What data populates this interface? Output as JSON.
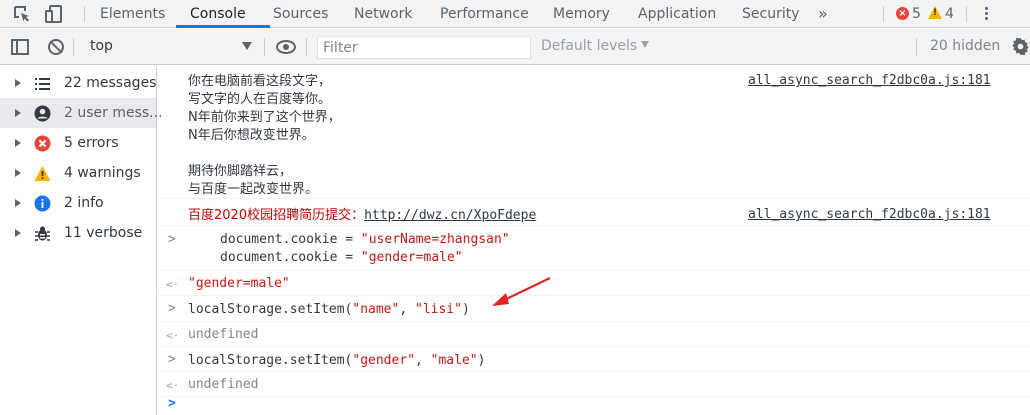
{
  "tabs": [
    "Elements",
    "Console",
    "Sources",
    "Network",
    "Performance",
    "Memory",
    "Application",
    "Security"
  ],
  "active_tab": "Console",
  "more_tabs": "»",
  "error_count": "5",
  "warning_count": "4",
  "toolbar": {
    "context": "top",
    "filter_placeholder": "Filter",
    "levels": "Default levels",
    "hidden": "20 hidden"
  },
  "sidebar": [
    {
      "label": "22 messages",
      "icon": "list-icon"
    },
    {
      "label": "2 user mess...",
      "icon": "user-icon"
    },
    {
      "label": "5 errors",
      "icon": "error-icon"
    },
    {
      "label": "4 warnings",
      "icon": "warning-icon"
    },
    {
      "label": "2 info",
      "icon": "info-icon"
    },
    {
      "label": "11 verbose",
      "icon": "bug-icon"
    }
  ],
  "log1": {
    "lines": [
      "你在电脑前看这段文字，",
      "写文字的人在百度等你。",
      "N年前你来到了这个世界，",
      "N年后你想改变世界。",
      "",
      "期待你脚踏祥云，",
      "与百度一起改变世界。"
    ],
    "source": "all_async_search_f2dbc0a.js:181"
  },
  "log2": {
    "prefix": "百度2020校园招聘简历提交：",
    "url": "http://dwz.cn/XpoFdepe",
    "source": "all_async_search_f2dbc0a.js:181"
  },
  "cmd1": {
    "line1_code": "document.cookie = ",
    "line1_str": "\"userName=zhangsan\"",
    "line2_code": "document.cookie = ",
    "line2_str": "\"gender=male\""
  },
  "result1": "\"gender=male\"",
  "cmd2": {
    "p1": "localStorage.setItem(",
    "a1": "\"name\"",
    "sep": ", ",
    "a2": "\"lisi\"",
    "p2": ")"
  },
  "result2": "undefined",
  "cmd3": {
    "p1": "localStorage.setItem(",
    "a1": "\"gender\"",
    "sep": ", ",
    "a2": "\"male\"",
    "p2": ")"
  },
  "result3": "undefined",
  "prompt_symbol": ">",
  "return_symbol": "<·",
  "colors": {
    "accent": "#1a73e8",
    "error": "#e8453c",
    "warning": "#f4b400",
    "string": "#c41a16",
    "annotation": "#e02424"
  }
}
